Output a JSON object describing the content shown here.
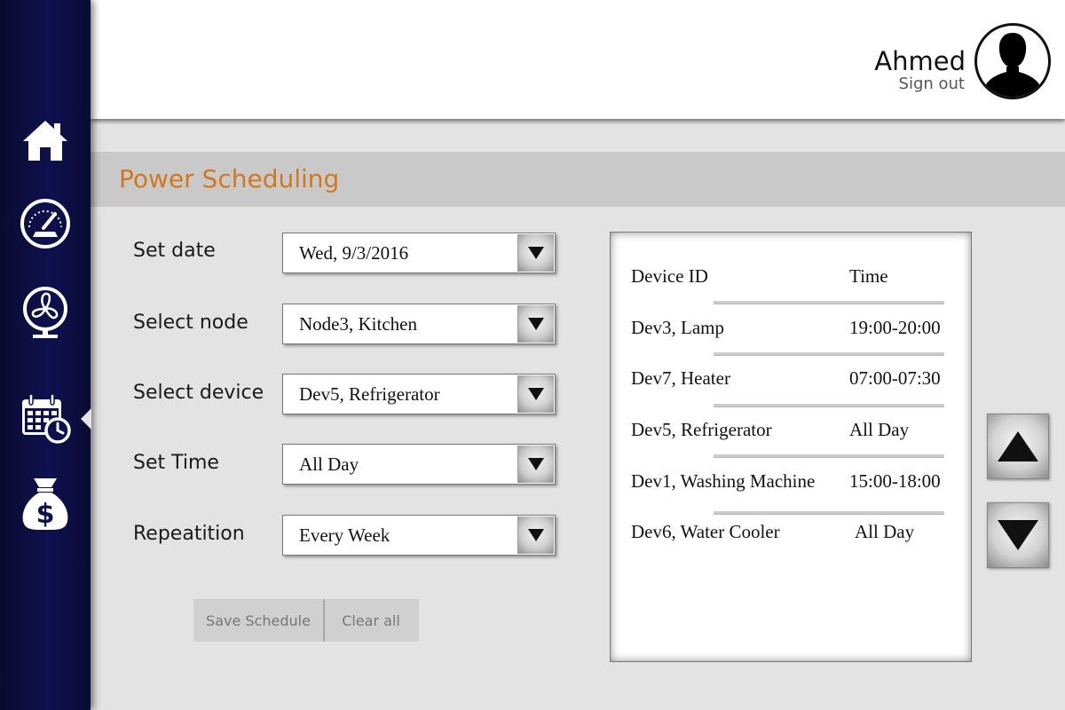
{
  "sidebar": {
    "items": [
      {
        "name": "home",
        "icon": "home-icon"
      },
      {
        "name": "dashboard",
        "icon": "gauge-icon"
      },
      {
        "name": "devices",
        "icon": "fan-icon"
      },
      {
        "name": "scheduling",
        "icon": "calendar-clock-icon",
        "active": true
      },
      {
        "name": "billing",
        "icon": "money-bag-icon"
      }
    ]
  },
  "header": {
    "user_name": "Ahmed",
    "sign_out": "Sign out",
    "avatar_icon": "user-silhouette-icon"
  },
  "page": {
    "title": "Power Scheduling",
    "title_color": "#d2781f"
  },
  "form": {
    "date": {
      "label": "Set date",
      "value": "Wed, 9/3/2016"
    },
    "node": {
      "label": "Select node",
      "value": "Node3, Kitchen"
    },
    "device": {
      "label": "Select device",
      "value": "Dev5, Refrigerator"
    },
    "time": {
      "label": "Set Time",
      "value": "All Day"
    },
    "repetition": {
      "label": "Repeatition",
      "value": "Every Week"
    }
  },
  "buttons": {
    "save": "Save Schedule",
    "clear": "Clear all"
  },
  "schedule": {
    "headers": {
      "device": "Device ID",
      "time": "Time"
    },
    "rows": [
      {
        "device": "Dev3, Lamp",
        "time": "19:00-20:00"
      },
      {
        "device": "Dev7, Heater",
        "time": "07:00-07:30"
      },
      {
        "device": "Dev5, Refrigerator",
        "time": "All Day"
      },
      {
        "device": "Dev1, Washing Machine",
        "time": "15:00-18:00"
      },
      {
        "device": "Dev6, Water Cooler",
        "time": "All Day"
      }
    ]
  },
  "scroll": {
    "up_icon": "triangle-up-icon",
    "down_icon": "triangle-down-icon"
  }
}
